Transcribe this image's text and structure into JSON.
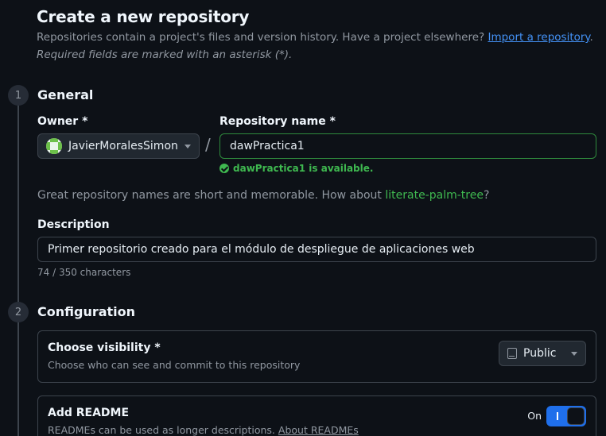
{
  "header": {
    "title": "Create a new repository",
    "subtitle": "Repositories contain a project's files and version history. Have a project elsewhere?",
    "import_link": "Import a repository",
    "subtitle_end": ".",
    "required_note": "Required fields are marked with an asterisk (*)."
  },
  "steps": [
    {
      "number": "1",
      "title": "General"
    },
    {
      "number": "2",
      "title": "Configuration"
    }
  ],
  "general": {
    "owner_label": "Owner *",
    "owner_value": "JavierMoralesSimon",
    "separator": "/",
    "repo_name_label": "Repository name *",
    "repo_name_value": "dawPractica1",
    "availability": "dawPractica1 is available.",
    "suggestion_text": "Great repository names are short and memorable. How about",
    "suggestion_name": "literate-palm-tree",
    "suggestion_end": "?",
    "description_label": "Description",
    "description_value": "Primer repositorio creado para el módulo de despliegue de aplicaciones web",
    "char_count": "74 / 350 characters"
  },
  "configuration": {
    "visibility_title": "Choose visibility *",
    "visibility_desc": "Choose who can see and commit to this repository",
    "visibility_value": "Public",
    "readme_title": "Add README",
    "readme_desc": "READMEs can be used as longer descriptions.",
    "readme_link": "About READMEs",
    "readme_toggle_label": "On",
    "readme_enabled": true
  },
  "colors": {
    "background": "#0d1117",
    "accent_blue": "#1f6feb",
    "success_green": "#3fb950",
    "link_blue": "#4493f8"
  },
  "icons": [
    "avatar",
    "chevron-down-icon",
    "check-circle-icon",
    "repo-icon"
  ]
}
